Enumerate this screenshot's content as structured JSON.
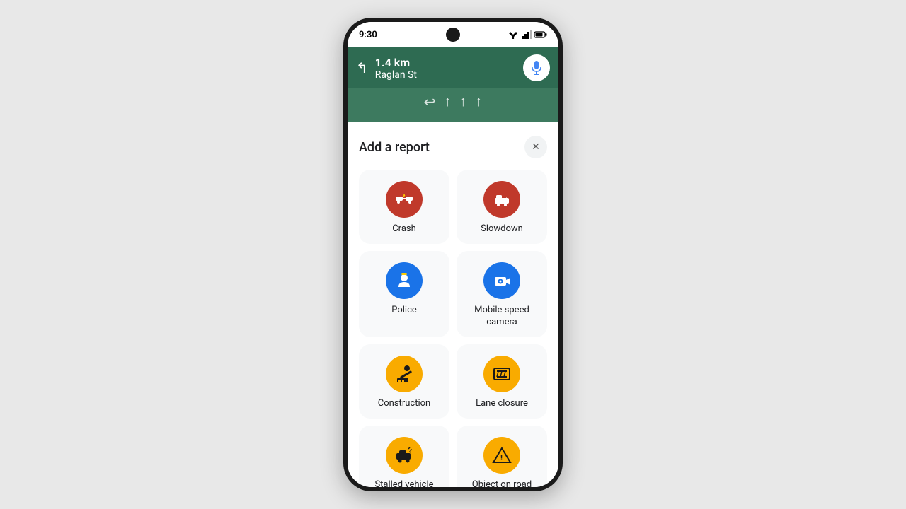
{
  "statusBar": {
    "time": "9:30"
  },
  "map": {
    "distance": "1.4 km",
    "street": "Raglan St",
    "micIcon": "🎤"
  },
  "sheet": {
    "title": "Add a report",
    "closeLabel": "✕",
    "items": [
      {
        "id": "crash",
        "label": "Crash",
        "iconColor": "icon-red",
        "icon": "💥",
        "svgType": "crash"
      },
      {
        "id": "slowdown",
        "label": "Slowdown",
        "iconColor": "icon-red",
        "icon": "🐢",
        "svgType": "slowdown"
      },
      {
        "id": "police",
        "label": "Police",
        "iconColor": "icon-blue",
        "icon": "👮",
        "svgType": "police"
      },
      {
        "id": "mobile-speed-camera",
        "label": "Mobile speed camera",
        "iconColor": "icon-blue",
        "icon": "📷",
        "svgType": "camera"
      },
      {
        "id": "construction",
        "label": "Construction",
        "iconColor": "icon-yellow",
        "icon": "🚧",
        "svgType": "construction"
      },
      {
        "id": "lane-closure",
        "label": "Lane closure",
        "iconColor": "icon-yellow",
        "icon": "🚦",
        "svgType": "lane"
      },
      {
        "id": "stalled-vehicle",
        "label": "Stalled vehicle",
        "iconColor": "icon-yellow",
        "icon": "🚗",
        "svgType": "stalled"
      },
      {
        "id": "object-on-road",
        "label": "Object on road",
        "iconColor": "icon-yellow",
        "icon": "⚠️",
        "svgType": "object"
      }
    ]
  }
}
